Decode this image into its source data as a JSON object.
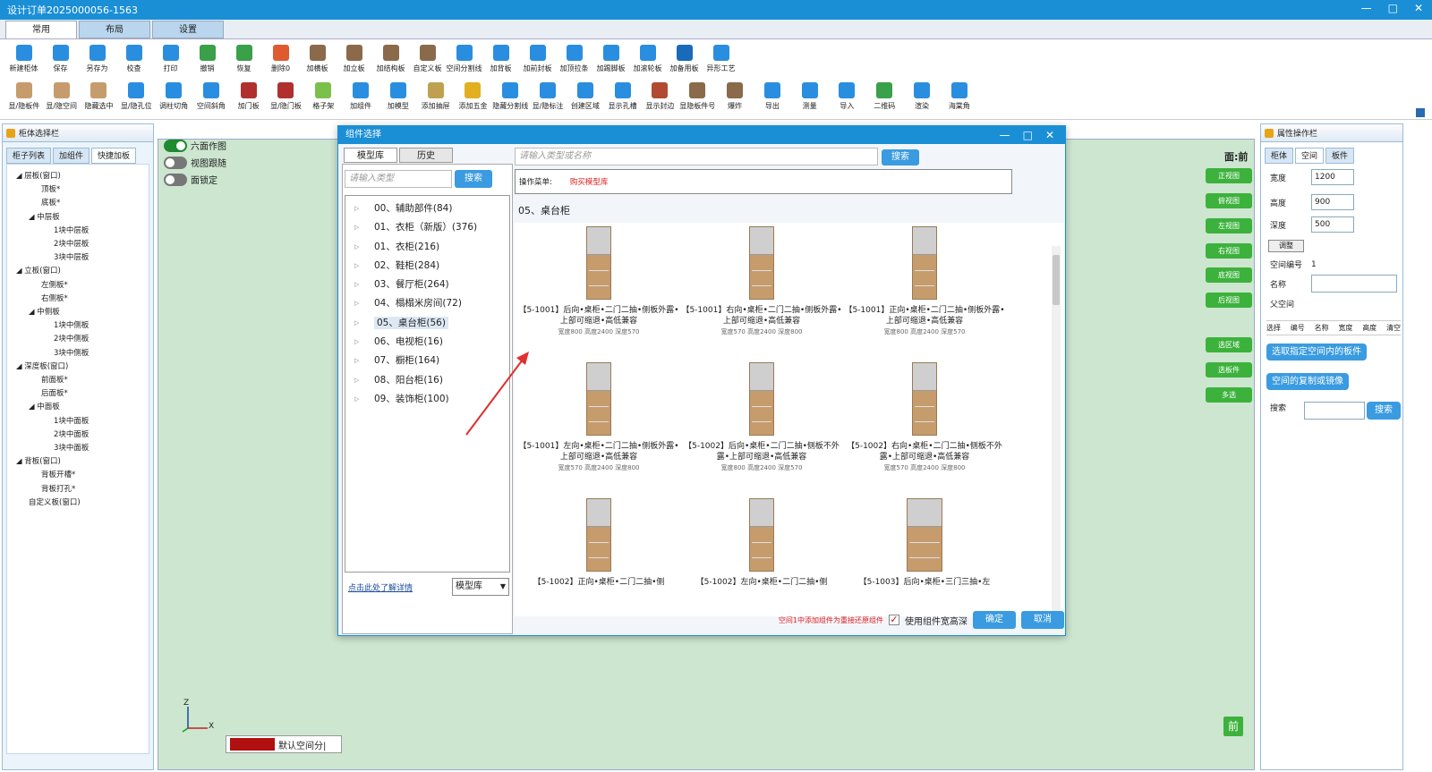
{
  "window": {
    "title": "设计订单2025000056-1563",
    "controls": [
      "—",
      "□",
      "✕"
    ]
  },
  "tabs": [
    "常用",
    "布局",
    "设置"
  ],
  "toolbar_row1": [
    {
      "label": "新建柜体",
      "icon": "new-cabinet-icon",
      "color": "#2a8ee0"
    },
    {
      "label": "保存",
      "icon": "save-icon",
      "color": "#2a8ee0"
    },
    {
      "label": "另存为",
      "icon": "save-as-icon",
      "color": "#2a8ee0"
    },
    {
      "label": "校查",
      "icon": "check-icon",
      "color": "#2a8ee0"
    },
    {
      "label": "打印",
      "icon": "print-icon",
      "color": "#2a8ee0"
    },
    {
      "label": "撤销",
      "icon": "undo-icon",
      "color": "#3aa04a"
    },
    {
      "label": "恢复",
      "icon": "redo-icon",
      "color": "#3aa04a"
    },
    {
      "label": "删除0",
      "icon": "delete-icon",
      "color": "#e05a30"
    },
    {
      "label": "加横板",
      "icon": "horizontal-board-icon",
      "color": "#8a6a4a"
    },
    {
      "label": "加立板",
      "icon": "vertical-board-icon",
      "color": "#8a6a4a"
    },
    {
      "label": "加结构板",
      "icon": "structure-board-icon",
      "color": "#8a6a4a"
    },
    {
      "label": "自定义板",
      "icon": "custom-board-icon",
      "color": "#8a6a4a"
    },
    {
      "label": "空间分割线",
      "icon": "space-split-icon",
      "color": "#2a8ee0"
    },
    {
      "label": "加背板",
      "icon": "back-board-icon",
      "color": "#2a8ee0"
    },
    {
      "label": "加前封板",
      "icon": "front-seal-icon",
      "color": "#2a8ee0"
    },
    {
      "label": "加顶拉条",
      "icon": "top-strip-icon",
      "color": "#2a8ee0"
    },
    {
      "label": "加踢脚板",
      "icon": "kick-board-icon",
      "color": "#2a8ee0"
    },
    {
      "label": "加滚轮板",
      "icon": "wheel-board-icon",
      "color": "#2a8ee0"
    },
    {
      "label": "加备用板",
      "icon": "spare-board-icon",
      "color": "#1a6aba"
    },
    {
      "label": "异形工艺",
      "icon": "shaped-craft-icon",
      "color": "#2a8ee0"
    }
  ],
  "toolbar_row2": [
    {
      "label": "显/隐板件",
      "icon": "show-hide-board-icon",
      "color": "#c69c6d"
    },
    {
      "label": "显/隐空间",
      "icon": "show-hide-space-icon",
      "color": "#c69c6d"
    },
    {
      "label": "隐藏选中",
      "icon": "hide-selected-icon",
      "color": "#c69c6d"
    },
    {
      "label": "显/隐孔位",
      "icon": "show-hide-holes-icon",
      "color": "#2a8ee0"
    },
    {
      "label": "调柱切角",
      "icon": "pillar-cut-icon",
      "color": "#2a8ee0"
    },
    {
      "label": "空间斜角",
      "icon": "space-bevel-icon",
      "color": "#2a8ee0"
    },
    {
      "label": "加门板",
      "icon": "add-door-icon",
      "color": "#b03030"
    },
    {
      "label": "显/隐门板",
      "icon": "show-hide-door-icon",
      "color": "#b03030"
    },
    {
      "label": "格子架",
      "icon": "grid-shelf-icon",
      "color": "#7ac04a"
    },
    {
      "label": "加组件",
      "icon": "add-component-icon",
      "color": "#2a8ee0"
    },
    {
      "label": "加模型",
      "icon": "add-model-icon",
      "color": "#2a8ee0"
    },
    {
      "label": "添加抽屉",
      "icon": "add-drawer-icon",
      "color": "#c0a050"
    },
    {
      "label": "添加五金",
      "icon": "add-hardware-icon",
      "color": "#e0b020"
    },
    {
      "label": "隐藏分割线",
      "icon": "hide-split-icon",
      "color": "#2a8ee0"
    },
    {
      "label": "显/隐标注",
      "icon": "show-hide-annotation-icon",
      "color": "#2a8ee0"
    },
    {
      "label": "创建区域",
      "icon": "create-region-icon",
      "color": "#2a8ee0"
    },
    {
      "label": "显示孔槽",
      "icon": "show-slot-icon",
      "color": "#2a8ee0"
    },
    {
      "label": "显示封边",
      "icon": "show-edge-icon",
      "color": "#b04a30"
    },
    {
      "label": "显隐板件号",
      "icon": "board-number-icon",
      "color": "#8a6a4a"
    },
    {
      "label": "爆炸",
      "icon": "explode-icon",
      "color": "#8a6a4a"
    },
    {
      "label": "导出",
      "icon": "export-icon",
      "color": "#2a8ee0"
    },
    {
      "label": "测量",
      "icon": "measure-icon",
      "color": "#2a8ee0"
    },
    {
      "label": "导入",
      "icon": "import-icon",
      "color": "#2a8ee0"
    },
    {
      "label": "二维码",
      "icon": "qrcode-icon",
      "color": "#3aa04a"
    },
    {
      "label": "渲染",
      "icon": "render-icon",
      "color": "#2a8ee0"
    },
    {
      "label": "海棠角",
      "icon": "begonia-corner-icon",
      "color": "#2a8ee0"
    }
  ],
  "left_panel": {
    "title": "柜体选择栏",
    "tabs": [
      "柜子列表",
      "加组件",
      "快捷加板"
    ],
    "tree": [
      {
        "text": "◢ 层板(窗口)",
        "level": 0
      },
      {
        "text": "顶板*",
        "level": 2
      },
      {
        "text": "底板*",
        "level": 2
      },
      {
        "text": "◢ 中层板",
        "level": 1
      },
      {
        "text": "1块中层板",
        "level": 3
      },
      {
        "text": "2块中层板",
        "level": 3
      },
      {
        "text": "3块中层板",
        "level": 3
      },
      {
        "text": "◢ 立板(窗口)",
        "level": 0
      },
      {
        "text": "左侧板*",
        "level": 2
      },
      {
        "text": "右侧板*",
        "level": 2
      },
      {
        "text": "◢ 中侧板",
        "level": 1
      },
      {
        "text": "1块中侧板",
        "level": 3
      },
      {
        "text": "2块中侧板",
        "level": 3
      },
      {
        "text": "3块中侧板",
        "level": 3
      },
      {
        "text": "◢ 深度板(窗口)",
        "level": 0
      },
      {
        "text": "前面板*",
        "level": 2
      },
      {
        "text": "后面板*",
        "level": 2
      },
      {
        "text": "◢ 中面板",
        "level": 1
      },
      {
        "text": "1块中面板",
        "level": 3
      },
      {
        "text": "2块中面板",
        "level": 3
      },
      {
        "text": "3块中面板",
        "level": 3
      },
      {
        "text": "◢ 背板(窗口)",
        "level": 0
      },
      {
        "text": "背板开槽*",
        "level": 2
      },
      {
        "text": "背板打孔*",
        "level": 2
      },
      {
        "text": "自定义板(窗口)",
        "level": 1
      }
    ]
  },
  "toggles": [
    {
      "label": "六面作图",
      "on": true
    },
    {
      "label": "视图跟随",
      "on": false
    },
    {
      "label": "面锁定",
      "on": false
    }
  ],
  "view_label": "面:前",
  "view_buttons": [
    "正视图",
    "俯视图",
    "左视图",
    "右视图",
    "底视图",
    "后视图"
  ],
  "select_buttons": [
    "选区域",
    "选板件",
    "多选"
  ],
  "axis": {
    "z": "Z",
    "x": "X"
  },
  "status": {
    "text": "默认空间分|",
    "swatch": "#b01010"
  },
  "front_badge": "前",
  "right_panel": {
    "title": "属性操作栏",
    "tabs": [
      "柜体",
      "空间",
      "板件"
    ],
    "fields": [
      {
        "label": "宽度",
        "value": "1200"
      },
      {
        "label": "高度",
        "value": "900"
      },
      {
        "label": "深度",
        "value": "500"
      }
    ],
    "adjust_label": "调整",
    "space_no_label": "空间编号",
    "space_no": "1",
    "name_label": "名称",
    "parent_label": "父空间",
    "columns": [
      "选择",
      "编号",
      "名称",
      "宽度",
      "高度",
      "清空"
    ],
    "btn_select": "选取指定空间内的板件",
    "btn_copy": "空间的复制或镜像",
    "search_label": "搜索",
    "search_btn": "搜索"
  },
  "dialog": {
    "title": "组件选择",
    "controls": [
      "—",
      "□",
      "✕"
    ],
    "tabs": [
      "模型库",
      "历史"
    ],
    "left_search_placeholder": "请输入类型",
    "left_search_btn": "搜索",
    "categories": [
      "00、辅助部件(84)",
      "01、衣柜（新版）(376)",
      "01、衣柜(216)",
      "02、鞋柜(284)",
      "03、餐厅柜(264)",
      "04、榻榻米房间(72)",
      "05、桌台柜(56)",
      "06、电视柜(16)",
      "07、橱柜(164)",
      "08、阳台柜(16)",
      "09、装饰柜(100)"
    ],
    "selected_category": 6,
    "details_link": "点击此处了解详情",
    "library_select": "模型库",
    "main_search_placeholder": "请输入类型或名称",
    "main_search_btn": "搜索",
    "op_menu_label": "操作菜单:",
    "op_menu_action": "购买模型库",
    "section_title": "05、桌台柜",
    "items": [
      {
        "name": "【5-1001】后向•桌柜•二门二抽•侧板外露•上部可缩退•高低兼容",
        "dims": "宽度800 高度2400 深度570"
      },
      {
        "name": "【5-1001】右向•桌柜•二门二抽•侧板外露•上部可缩退•高低兼容",
        "dims": "宽度570 高度2400 深度800"
      },
      {
        "name": "【5-1001】正向•桌柜•二门二抽•侧板外露•上部可缩退•高低兼容",
        "dims": "宽度800 高度2400 深度570"
      },
      {
        "name": "【5-1001】左向•桌柜•二门二抽•侧板外露•上部可缩退•高低兼容",
        "dims": "宽度570 高度2400 深度800"
      },
      {
        "name": "【5-1002】后向•桌柜•二门二抽•侧板不外露•上部可缩退•高低兼容",
        "dims": "宽度800 高度2400 深度570"
      },
      {
        "name": "【5-1002】右向•桌柜•二门二抽•侧板不外露•上部可缩退•高低兼容",
        "dims": "宽度570 高度2400 深度800"
      },
      {
        "name": "【5-1002】正向•桌柜•二门二抽•侧",
        "dims": ""
      },
      {
        "name": "【5-1002】左向•桌柜•二门二抽•侧",
        "dims": ""
      },
      {
        "name": "【5-1003】后向•桌柜•三门三抽•左",
        "dims": ""
      }
    ],
    "footer_note": "空间1中添加组件为重接还原组件",
    "use_dims_label": "使用组件宽高深",
    "use_dims_checked": true,
    "ok": "确定",
    "cancel": "取消"
  }
}
